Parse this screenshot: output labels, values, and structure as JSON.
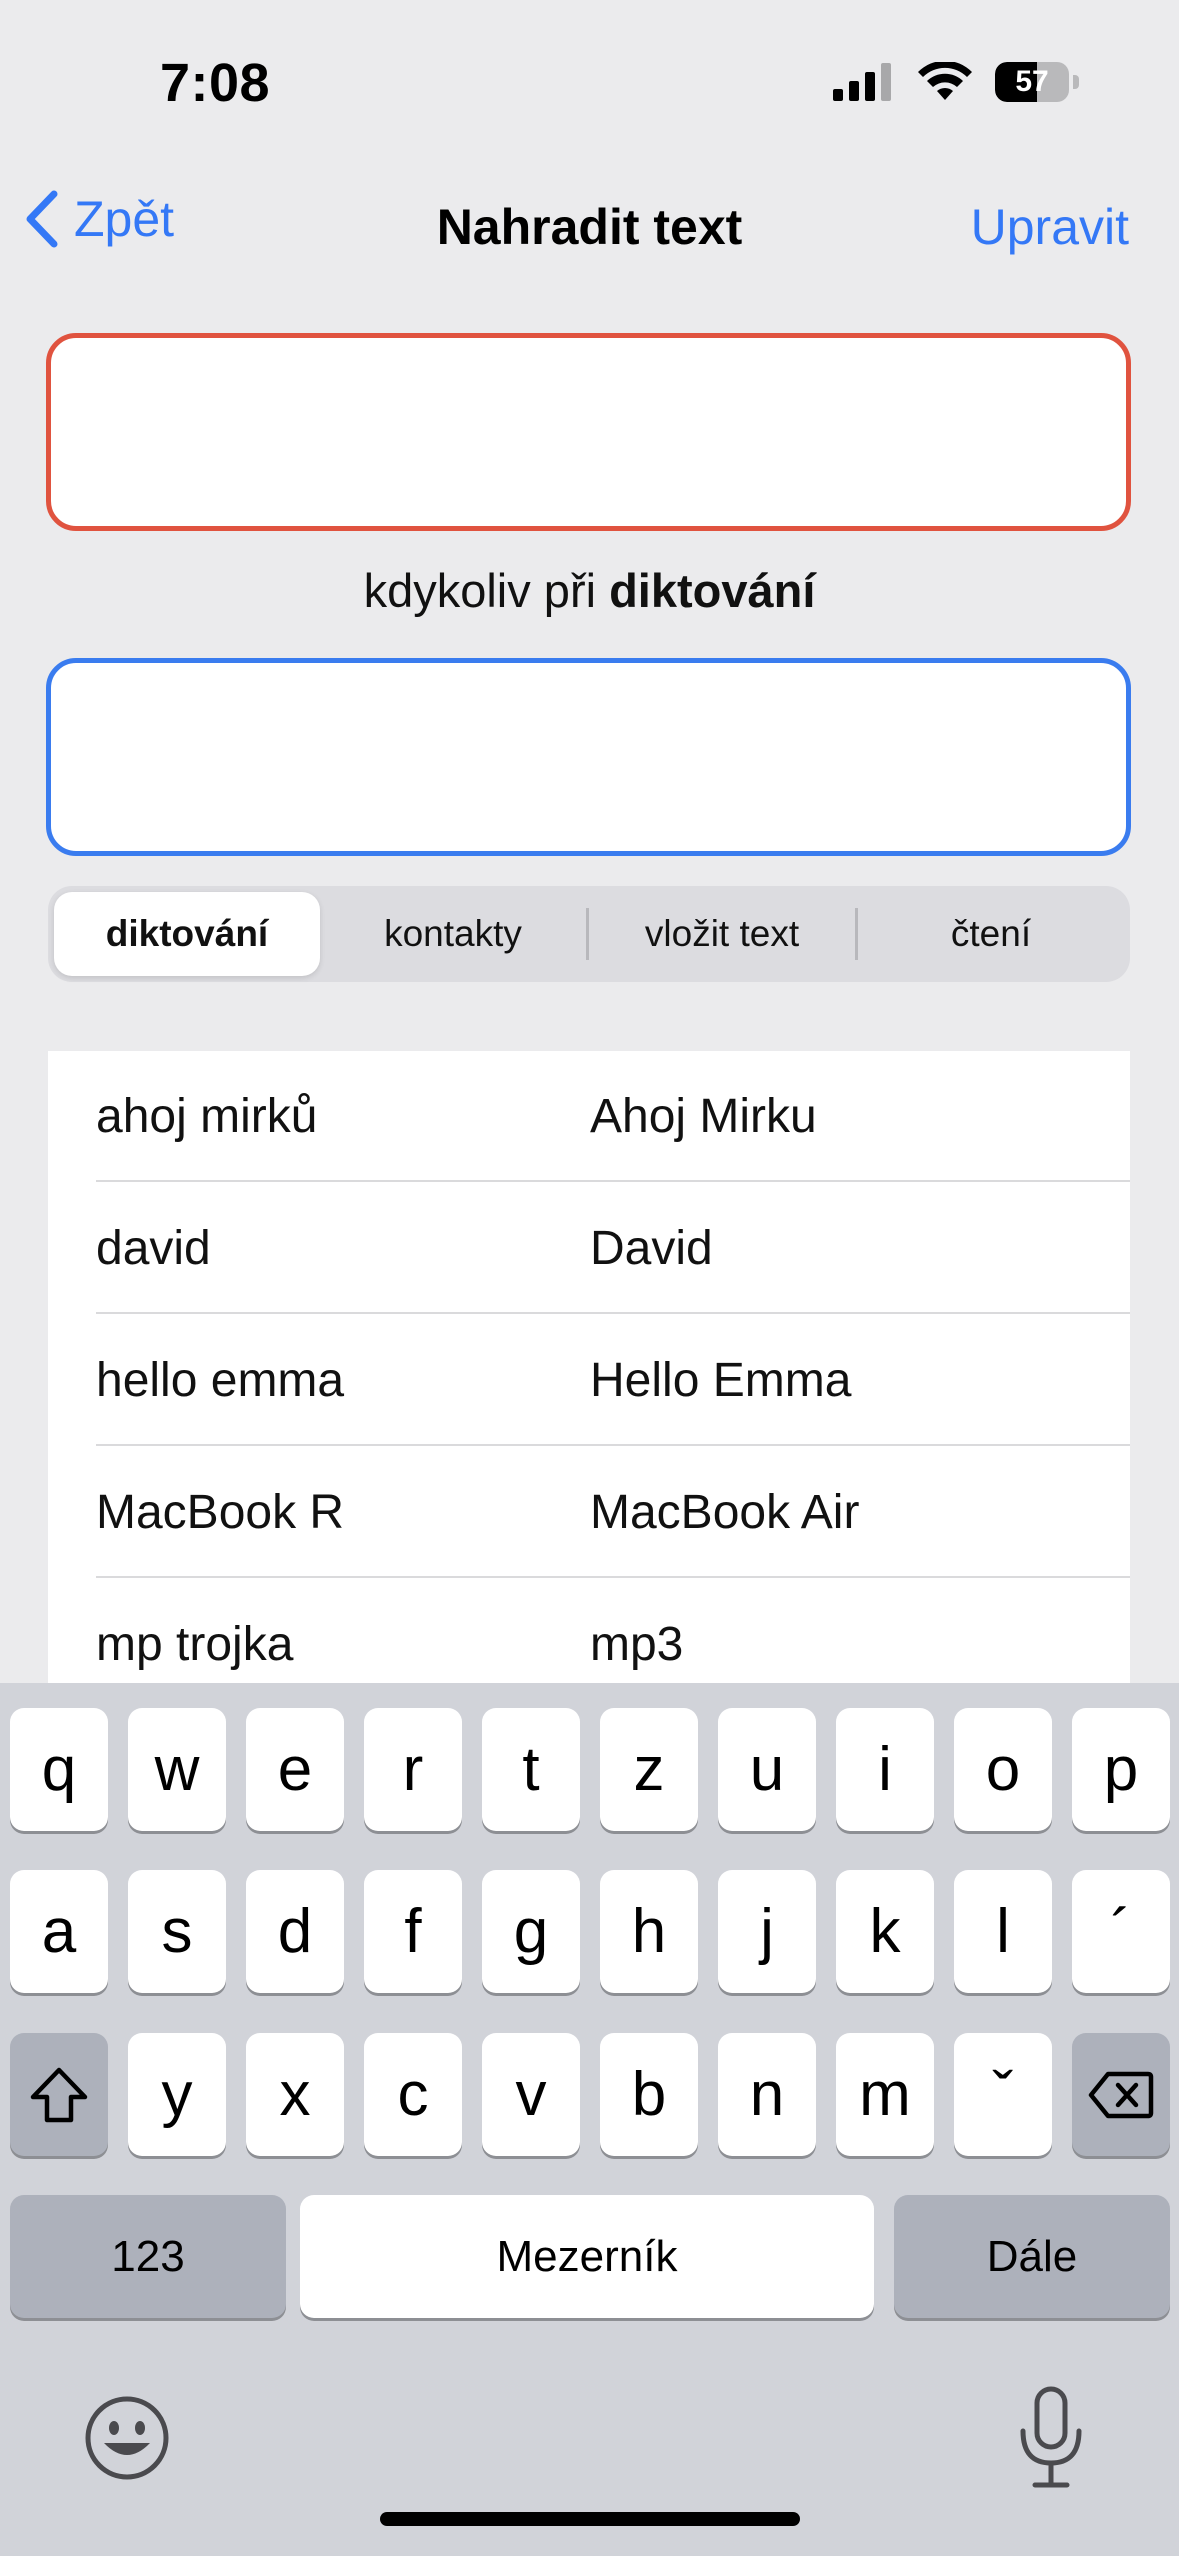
{
  "status": {
    "time": "7:08",
    "battery": "57",
    "battery_level_percent": 57
  },
  "nav": {
    "back_label": "Zpět",
    "title": "Nahradit text",
    "edit_label": "Upravit"
  },
  "fields": {
    "phrase_value": "",
    "replacement_value": "",
    "caption_prefix": "kdykoliv při",
    "caption_bold": "diktování"
  },
  "segments": [
    {
      "label": "diktování",
      "active": true
    },
    {
      "label": "kontakty",
      "active": false
    },
    {
      "label": "vložit text",
      "active": false
    },
    {
      "label": "čtení",
      "active": false
    }
  ],
  "replacements": [
    {
      "phrase": "ahoj mirků",
      "replacement": "Ahoj Mirku"
    },
    {
      "phrase": "david",
      "replacement": "David"
    },
    {
      "phrase": "hello emma",
      "replacement": "Hello Emma"
    },
    {
      "phrase": "MacBook R",
      "replacement": "MacBook Air"
    },
    {
      "phrase": "mp trojka",
      "replacement": "mp3"
    }
  ],
  "keyboard": {
    "row1": [
      "q",
      "w",
      "e",
      "r",
      "t",
      "z",
      "u",
      "i",
      "o",
      "p"
    ],
    "row2": [
      "a",
      "s",
      "d",
      "f",
      "g",
      "h",
      "j",
      "k",
      "l",
      "´"
    ],
    "row3": [
      "y",
      "x",
      "c",
      "v",
      "b",
      "n",
      "m",
      "ˇ"
    ],
    "numbers_label": "123",
    "space_label": "Mezerník",
    "return_label": "Dále",
    "icons": {
      "shift": "shift-icon",
      "backspace": "backspace-icon",
      "emoji": "emoji-icon",
      "mic": "microphone-icon"
    }
  },
  "colors": {
    "accent": "#3478f6",
    "phrase_border": "#e0533f",
    "replacement_border": "#3a7cef",
    "background": "#ebebed",
    "keyboard_bg": "#d1d3d9"
  }
}
